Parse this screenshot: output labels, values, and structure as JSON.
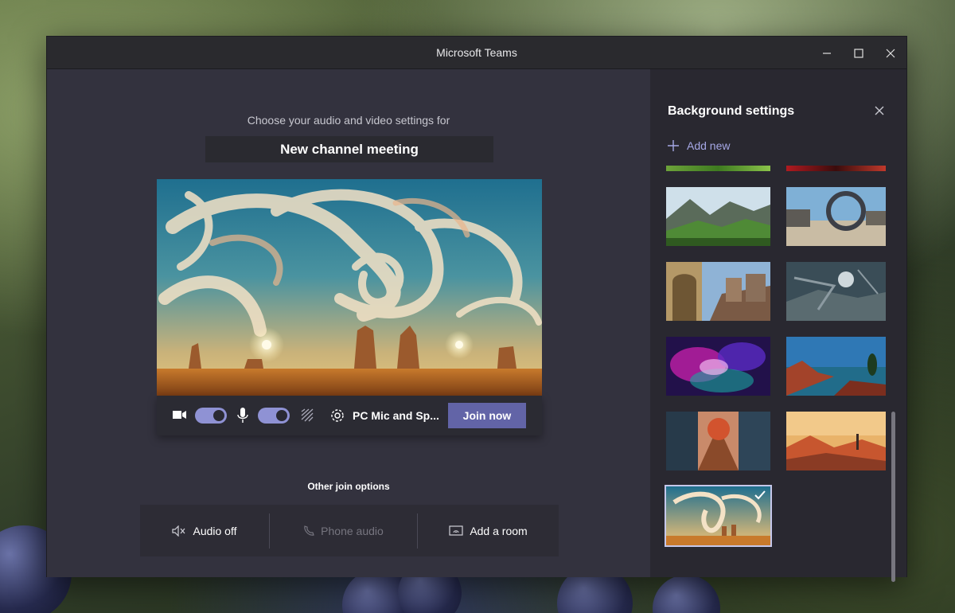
{
  "window": {
    "title": "Microsoft Teams"
  },
  "main": {
    "prompt": "Choose your audio and video settings for",
    "meeting_name": "New channel meeting",
    "camera_on": true,
    "mic_on": true,
    "device_label": "PC Mic and Sp...",
    "join_label": "Join now",
    "other_title": "Other join options",
    "options": [
      {
        "label": "Audio off",
        "icon": "speaker-mute-icon",
        "enabled": true
      },
      {
        "label": "Phone audio",
        "icon": "phone-icon",
        "enabled": false
      },
      {
        "label": "Add a room",
        "icon": "cast-screen-icon",
        "enabled": true
      }
    ]
  },
  "panel": {
    "title": "Background settings",
    "add_new_label": "Add new",
    "backgrounds": [
      {
        "name": "green-grass",
        "selected": false
      },
      {
        "name": "red-abstract",
        "selected": false
      },
      {
        "name": "mountain-valley",
        "selected": false
      },
      {
        "name": "ring-ruins",
        "selected": false
      },
      {
        "name": "fantasy-street",
        "selected": false
      },
      {
        "name": "space-station",
        "selected": false
      },
      {
        "name": "purple-nebula",
        "selected": false
      },
      {
        "name": "alien-coast",
        "selected": false
      },
      {
        "name": "autumn-street",
        "selected": false
      },
      {
        "name": "sunset-island",
        "selected": false
      },
      {
        "name": "swirl-desert",
        "selected": true
      }
    ]
  },
  "colors": {
    "accent": "#6264a7",
    "toggle": "#8f92d4",
    "link": "#a6a8e6"
  }
}
